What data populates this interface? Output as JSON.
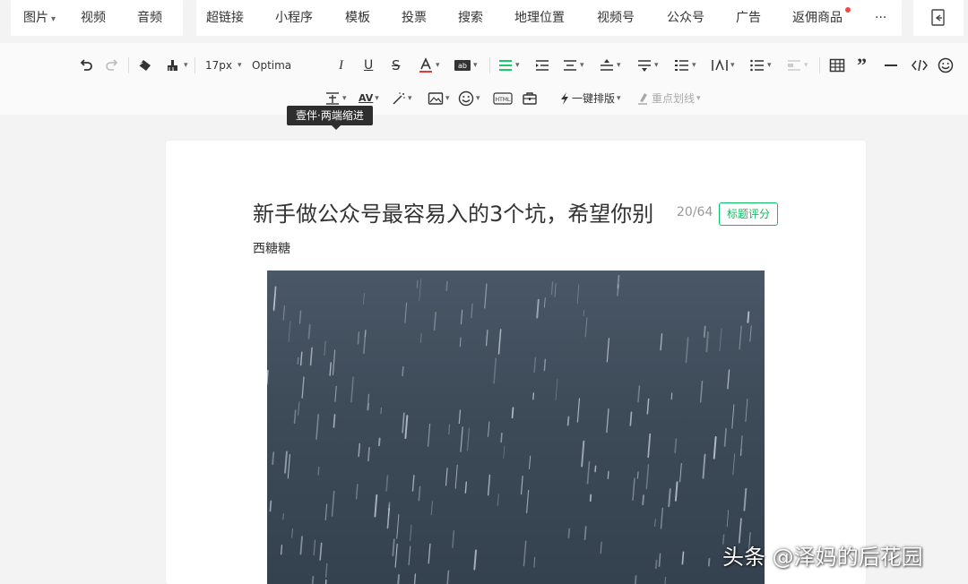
{
  "insert_bar": {
    "image": "图片",
    "video": "视频",
    "audio": "音频",
    "hyperlink": "超链接",
    "miniprogram": "小程序",
    "template": "模板",
    "vote": "投票",
    "search": "搜索",
    "location": "地理位置",
    "channels": "视频号",
    "official_account": "公众号",
    "ad": "广告",
    "rebate_goods": "返佣商品",
    "more": "···"
  },
  "format_bar": {
    "font_size": "17px",
    "font_family": "Optima",
    "tooltip": "壹伴·两端缩进",
    "one_click_layout": "一键排版",
    "key_underline": "重点划线"
  },
  "editor": {
    "title": "新手做公众号最容易入的3个坑，希望你别",
    "title_count": "20/64",
    "title_score_button": "标题评分",
    "author": "西糖糖"
  },
  "watermark": "头条 @泽妈的后花园",
  "colors": {
    "accent_green": "#07c160",
    "notification_dot": "#f24a3e",
    "cover_rain": "#3d4b59"
  }
}
